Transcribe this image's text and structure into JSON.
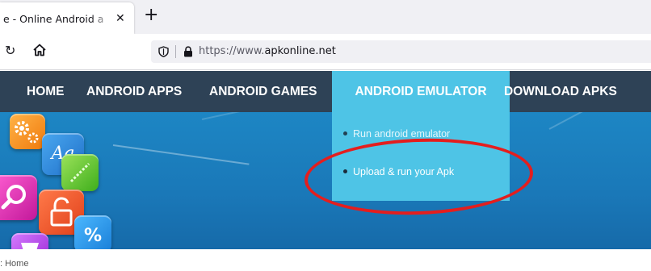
{
  "browser": {
    "tab_title": "e - Online Android a",
    "tab_close_glyph": "✕",
    "new_tab_glyph": "+",
    "reload_glyph": "↻",
    "url_prefix": "https://www.",
    "url_domain": "apkonline.net"
  },
  "site_nav": {
    "items": [
      {
        "label": "HOME"
      },
      {
        "label": "ANDROID APPS"
      },
      {
        "label": "ANDROID GAMES"
      },
      {
        "label": "ANDROID EMULATOR",
        "active": true
      },
      {
        "label": "DOWNLOAD APKS"
      }
    ],
    "active_color": "#4ec4e6",
    "bar_color": "#2e4256"
  },
  "dropdown": {
    "items": [
      {
        "label": "Run android emulator"
      },
      {
        "label": "Upload & run your Apk"
      }
    ]
  },
  "hero_tiles": {
    "aa_label": "Aa",
    "percent_label": "%"
  },
  "annotation": {
    "ellipse_color": "#e41e1e"
  },
  "breadcrumb": {
    "text": ": Home"
  }
}
